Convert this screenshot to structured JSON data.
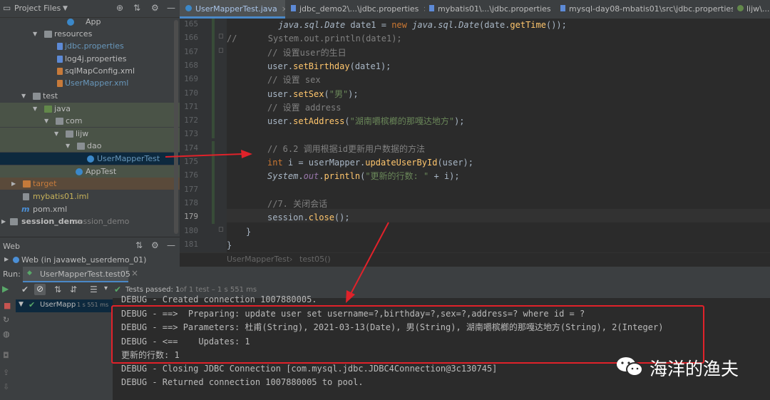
{
  "project": {
    "title": "Project Files",
    "tree": [
      {
        "label": "App",
        "kind": "class"
      },
      {
        "label": "resources",
        "kind": "folder"
      },
      {
        "label": "jdbc.properties",
        "kind": "file"
      },
      {
        "label": "log4j.properties",
        "kind": "file"
      },
      {
        "label": "sqlMapConfig.xml",
        "kind": "file"
      },
      {
        "label": "UserMapper.xml",
        "kind": "file"
      },
      {
        "label": "test",
        "kind": "folder"
      },
      {
        "label": "java",
        "kind": "folder"
      },
      {
        "label": "com",
        "kind": "folder"
      },
      {
        "label": "lijw",
        "kind": "folder"
      },
      {
        "label": "dao",
        "kind": "folder"
      },
      {
        "label": "UserMapperTest",
        "kind": "class"
      },
      {
        "label": "AppTest",
        "kind": "class"
      },
      {
        "label": "target",
        "kind": "folder"
      },
      {
        "label": "mybatis01.iml",
        "kind": "file"
      },
      {
        "label": "pom.xml",
        "kind": "file"
      },
      {
        "label": "session_demo",
        "kind": "module",
        "suffix": "session_demo"
      }
    ]
  },
  "web_panel": {
    "title": "Web",
    "item": "Web (in javaweb_userdemo_01)"
  },
  "tabs": [
    {
      "label": "UserMapperTest.java",
      "active": true
    },
    {
      "label": "jdbc_demo2\\...\\jdbc.properties"
    },
    {
      "label": "mybatis01\\...\\jdbc.properties"
    },
    {
      "label": "mysql-day08-mbatis01\\src\\jdbc.properties"
    },
    {
      "label": "lijw\\..."
    }
  ],
  "line_numbers": [
    "165",
    "166",
    "167",
    "168",
    "169",
    "170",
    "171",
    "172",
    "173",
    "174",
    "175",
    "176",
    "177",
    "178",
    "179",
    "180",
    "181"
  ],
  "code": {
    "l165": {
      "a": "java.sql.Date",
      "b": " date1 = ",
      "c": "new",
      "d": " ",
      "e": "java.sql.Date",
      "f": "(date.",
      "g": "getTime",
      "h": "());"
    },
    "l166": "//      System.out.println(date1);",
    "l167": "// 设置user的生日",
    "l168": {
      "a": "user.",
      "b": "setBirthday",
      "c": "(date1);"
    },
    "l169": "// 设置 sex",
    "l170": {
      "a": "user.",
      "b": "setSex",
      "c": "(",
      "d": "\"男\"",
      "e": ");"
    },
    "l171": "// 设置 address",
    "l172": {
      "a": "user.",
      "b": "setAddress",
      "c": "(",
      "d": "\"湖南嚼槟榔的那嘎达地方\"",
      "e": ");"
    },
    "l174": "// 6.2 调用根据id更新用户数据的方法",
    "l175": {
      "a": "int",
      "b": " i = userMapper.",
      "c": "updateUserById",
      "d": "(user);"
    },
    "l176": {
      "a": "System",
      "b": ".",
      "c": "out",
      "d": ".",
      "e": "println",
      "f": "(",
      "g": "\"更新的行数: \"",
      "h": " + i);"
    },
    "l178": "//7. 关闭会话",
    "l179": {
      "a": "session.",
      "b": "close",
      "c": "();"
    },
    "l180": "}",
    "l181": "}"
  },
  "breadcrumb": {
    "a": "UserMapperTest",
    "sep": "›",
    "b": "test05()"
  },
  "run": {
    "label": "Run:",
    "tab": "UserMapperTest.test05",
    "status_main": "Tests passed: 1",
    "status_detail": "of 1 test – 1 s 551 ms",
    "tree_item": "UserMapp",
    "tree_time": "1 s 551 ms"
  },
  "console": [
    "DEBUG - Created connection 1007880005.",
    "DEBUG - ==>  Preparing: update user set username=?,birthday=?,sex=?,address=? where id = ?",
    "DEBUG - ==> Parameters: 杜甫(String), 2021-03-13(Date), 男(String), 湖南嚼槟榔的那嘎达地方(String), 2(Integer)",
    "DEBUG - <==    Updates: 1",
    "更新的行数: 1",
    "DEBUG - Closing JDBC Connection [com.mysql.jdbc.JDBC4Connection@3c130745]",
    "DEBUG - Returned connection 1007880005 to pool."
  ],
  "watermark": "海洋的渔夫",
  "colors": {
    "annotation_red": "#e0222a",
    "accent_blue": "#4a88c7",
    "pass_green": "#59a869"
  }
}
